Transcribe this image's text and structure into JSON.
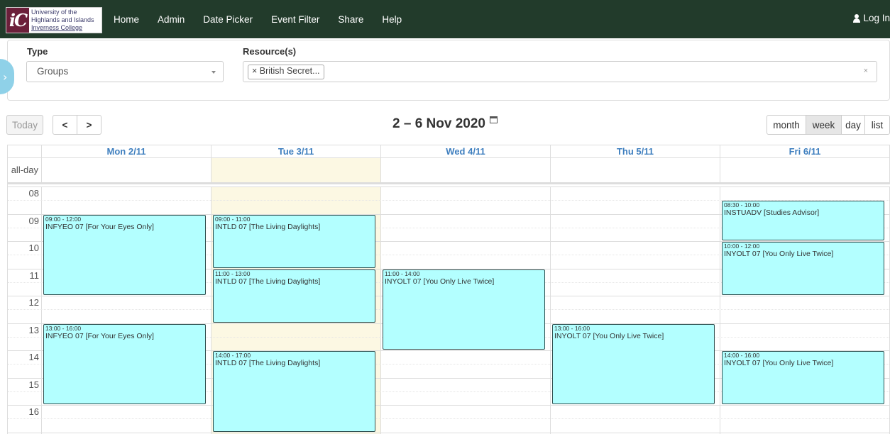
{
  "nav": {
    "logo": {
      "line1": "University of the",
      "line2": "Highlands and Islands",
      "line3": "Inverness College",
      "mark": "iC"
    },
    "links": [
      "Home",
      "Admin",
      "Date Picker",
      "Event Filter",
      "Share",
      "Help"
    ],
    "login": "Log In"
  },
  "filters": {
    "type_label": "Type",
    "type_value": "Groups",
    "resource_label": "Resource(s)",
    "resource_tag": "× British Secret...",
    "clear": "×"
  },
  "toolbar": {
    "today": "Today",
    "prev": "<",
    "next": ">",
    "title": "2 – 6 Nov 2020",
    "views": [
      "month",
      "week",
      "day",
      "list"
    ],
    "active_view": "week"
  },
  "calendar": {
    "allday_label": "all-day",
    "days": [
      "Mon 2/11",
      "Tue 3/11",
      "Wed 4/11",
      "Thu 5/11",
      "Fri 6/11"
    ],
    "today_index": 1,
    "hours": [
      "08",
      "09",
      "10",
      "11",
      "12",
      "13",
      "14",
      "15",
      "16"
    ],
    "events": [
      {
        "day": 0,
        "start": "09:00",
        "end": "12:00",
        "time": "09:00 - 12:00",
        "title": "INFYEO 07 [For Your Eyes Only]"
      },
      {
        "day": 0,
        "start": "13:00",
        "end": "16:00",
        "time": "13:00 - 16:00",
        "title": "INFYEO 07 [For Your Eyes Only]"
      },
      {
        "day": 1,
        "start": "09:00",
        "end": "11:00",
        "time": "09:00 - 11:00",
        "title": "INTLD 07 [The Living Daylights]"
      },
      {
        "day": 1,
        "start": "11:00",
        "end": "13:00",
        "time": "11:00 - 13:00",
        "title": "INTLD 07 [The Living Daylights]"
      },
      {
        "day": 1,
        "start": "14:00",
        "end": "17:00",
        "time": "14:00 - 17:00",
        "title": "INTLD 07 [The Living Daylights]"
      },
      {
        "day": 2,
        "start": "11:00",
        "end": "14:00",
        "time": "11:00 - 14:00",
        "title": "INYOLT 07 [You Only Live Twice]"
      },
      {
        "day": 3,
        "start": "13:00",
        "end": "16:00",
        "time": "13:00 - 16:00",
        "title": "INYOLT 07 [You Only Live Twice]"
      },
      {
        "day": 4,
        "start": "08:30",
        "end": "10:00",
        "time": "08:30 - 10:00",
        "title": "INSTUADV [Studies Advisor]"
      },
      {
        "day": 4,
        "start": "10:00",
        "end": "12:00",
        "time": "10:00 - 12:00",
        "title": "INYOLT 07 [You Only Live Twice]"
      },
      {
        "day": 4,
        "start": "14:00",
        "end": "16:00",
        "time": "14:00 - 16:00",
        "title": "INYOLT 07 [You Only Live Twice]"
      }
    ]
  },
  "colors": {
    "navbar": "#223b2b",
    "event_bg": "#b3ffff",
    "today_bg": "#fcf8e3",
    "day_header": "#3f7fbf"
  }
}
